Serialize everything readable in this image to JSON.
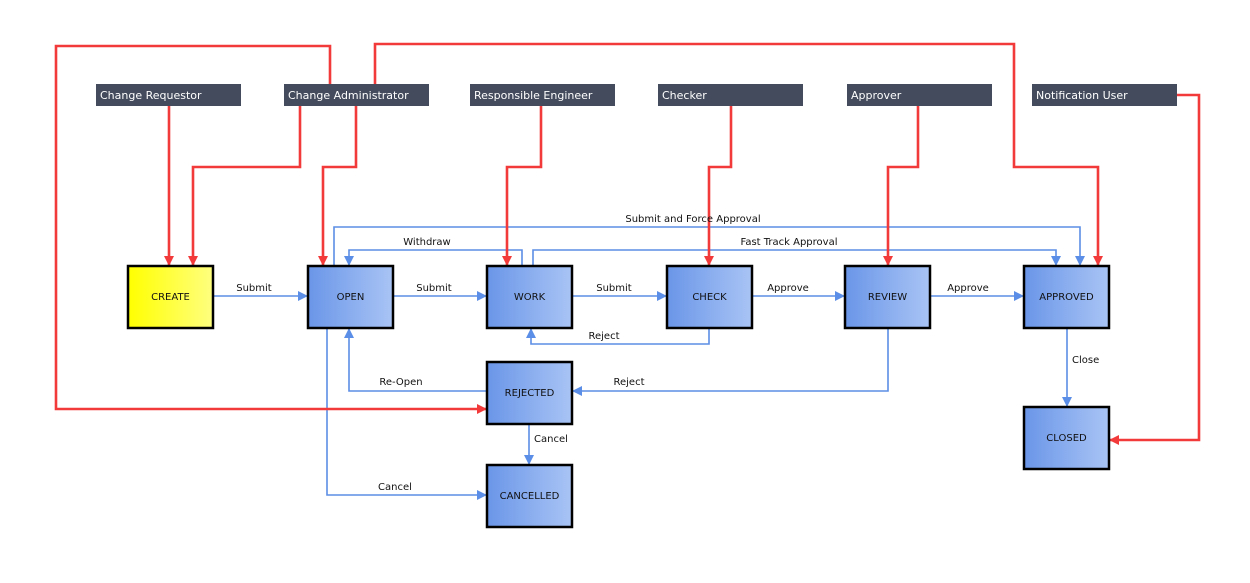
{
  "colors": {
    "role_bg": "#434b5c",
    "role_edge": "#f23a3a",
    "transition": "#5b8ee6",
    "node_blue_start": "#6a96e8",
    "node_blue_end": "#a9c4f5",
    "node_create_start": "#ffff00",
    "node_create_end": "#ffff80"
  },
  "roles": [
    {
      "id": "requestor",
      "label": "Change Requestor"
    },
    {
      "id": "admin",
      "label": "Change Administrator"
    },
    {
      "id": "engineer",
      "label": "Responsible Engineer"
    },
    {
      "id": "checker",
      "label": "Checker"
    },
    {
      "id": "approver",
      "label": "Approver"
    },
    {
      "id": "notify",
      "label": "Notification User"
    }
  ],
  "nodes": [
    {
      "id": "create",
      "label": "CREATE"
    },
    {
      "id": "open",
      "label": "OPEN"
    },
    {
      "id": "work",
      "label": "WORK"
    },
    {
      "id": "check",
      "label": "CHECK"
    },
    {
      "id": "review",
      "label": "REVIEW"
    },
    {
      "id": "approved",
      "label": "APPROVED"
    },
    {
      "id": "rejected",
      "label": "REJECTED"
    },
    {
      "id": "cancelled",
      "label": "CANCELLED"
    },
    {
      "id": "closed",
      "label": "CLOSED"
    }
  ],
  "transitions": [
    {
      "from": "CREATE",
      "to": "OPEN",
      "label": "Submit"
    },
    {
      "from": "OPEN",
      "to": "WORK",
      "label": "Submit"
    },
    {
      "from": "WORK",
      "to": "CHECK",
      "label": "Submit"
    },
    {
      "from": "CHECK",
      "to": "REVIEW",
      "label": "Approve"
    },
    {
      "from": "REVIEW",
      "to": "APPROVED",
      "label": "Approve"
    },
    {
      "from": "OPEN",
      "to": "APPROVED",
      "label": "Submit and Force Approval"
    },
    {
      "from": "WORK",
      "to": "OPEN",
      "label": "Withdraw"
    },
    {
      "from": "WORK",
      "to": "APPROVED",
      "label": "Fast Track Approval"
    },
    {
      "from": "CHECK",
      "to": "WORK",
      "label": "Reject"
    },
    {
      "from": "REJECTED",
      "to": "OPEN",
      "label": "Re-Open"
    },
    {
      "from": "REVIEW",
      "to": "REJECTED",
      "label": "Reject"
    },
    {
      "from": "REJECTED",
      "to": "CANCELLED",
      "label": "Cancel"
    },
    {
      "from": "OPEN",
      "to": "CANCELLED",
      "label": "Cancel"
    },
    {
      "from": "APPROVED",
      "to": "CLOSED",
      "label": "Close"
    }
  ],
  "assignments": [
    {
      "role": "Change Requestor",
      "state": "CREATE"
    },
    {
      "role": "Change Administrator",
      "state": "CREATE"
    },
    {
      "role": "Change Administrator",
      "state": "OPEN"
    },
    {
      "role": "Change Administrator",
      "state": "REJECTED"
    },
    {
      "role": "Change Administrator",
      "state": "APPROVED"
    },
    {
      "role": "Responsible Engineer",
      "state": "WORK"
    },
    {
      "role": "Checker",
      "state": "CHECK"
    },
    {
      "role": "Approver",
      "state": "REVIEW"
    },
    {
      "role": "Notification User",
      "state": "CLOSED"
    }
  ]
}
